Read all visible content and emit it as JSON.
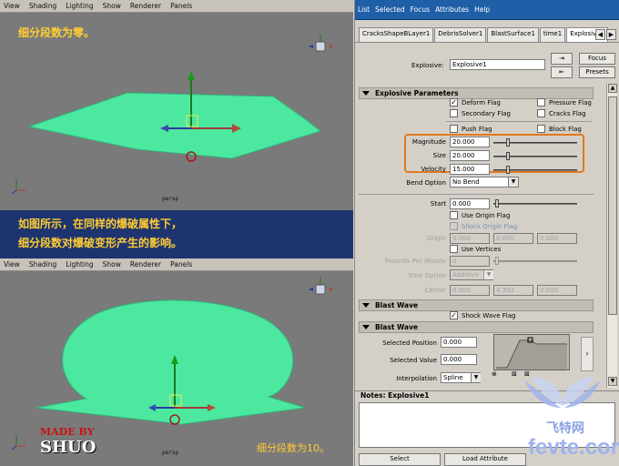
{
  "viewport_menu": [
    "View",
    "Shading",
    "Lighting",
    "Show",
    "Renderer",
    "Panels"
  ],
  "captions": {
    "top": "细分段数为零。",
    "middle_line1": "如图所示，在同样的爆破属性下，",
    "middle_line2": "细分段数对爆破变形产生的影响。",
    "bottom": "细分段数为10。"
  },
  "persp_label": "persp",
  "axis_labels": {
    "x": "x",
    "y": "y",
    "z": "z"
  },
  "watermark": {
    "made_by": "MADE BY",
    "shuo": "SHUO",
    "site": "飞特网",
    "site_url": "fevte.com"
  },
  "editor_menu": [
    "List",
    "Selected",
    "Focus",
    "Attributes",
    "Help"
  ],
  "tabs": [
    "CracksShapeBLayer1",
    "DebrisSolver1",
    "BlastSurface1",
    "time1",
    "Explosive1"
  ],
  "node": {
    "label": "Explosive:",
    "value": "Explosive1",
    "focus": "Focus",
    "presets": "Presets"
  },
  "explosive_parameters": {
    "title": "Explosive Parameters",
    "checkboxes": [
      {
        "label": "Deform Flag",
        "checked": true
      },
      {
        "label": "Pressure Flag",
        "checked": false
      },
      {
        "label": "Secondary Flag",
        "checked": false
      },
      {
        "label": "Cracks Flag",
        "checked": false
      },
      {
        "label": "Push Flag",
        "checked": false
      },
      {
        "label": "Block Flag",
        "checked": false
      }
    ],
    "magnitude_label": "Magnitude",
    "magnitude": "20.000",
    "size_label": "Size",
    "size": "20.000",
    "velocity_label": "Velocity",
    "velocity": "15.000",
    "bend_label": "Bend Option",
    "bend_value": "No Bend",
    "start_label": "Start",
    "start": "0.000",
    "use_origin": "Use Origin Flag",
    "shock_origin": "Shock Origin Flag",
    "origin_label": "Origin",
    "origin": [
      "0.000",
      "0.000",
      "0.000"
    ],
    "use_vertices": "Use Vertices",
    "fpm_label": "Frounds Per Minute",
    "fpm": "0",
    "shot_label": "Shot Option",
    "shot_value": "Additive",
    "center_label": "Center",
    "center": [
      "0.000",
      "4.302",
      "0.000"
    ]
  },
  "blast_wave": {
    "title": "Blast Wave",
    "shock_wave": "Shock Wave Flag",
    "subtitle": "Blast Wave",
    "selected_position_label": "Selected Position",
    "selected_position": "0.000",
    "selected_value_label": "Selected Value",
    "selected_value": "0.000",
    "interpolation_label": "Interpolation",
    "interpolation": "Spline"
  },
  "notes": {
    "title": "Notes: Explosive1"
  },
  "bottom_buttons": {
    "select": "Select",
    "load": "Load Attribute"
  },
  "colors": {
    "highlight": "#e07a1f",
    "surface": "#4de8a0",
    "titlebar": "#1f5fa8"
  }
}
